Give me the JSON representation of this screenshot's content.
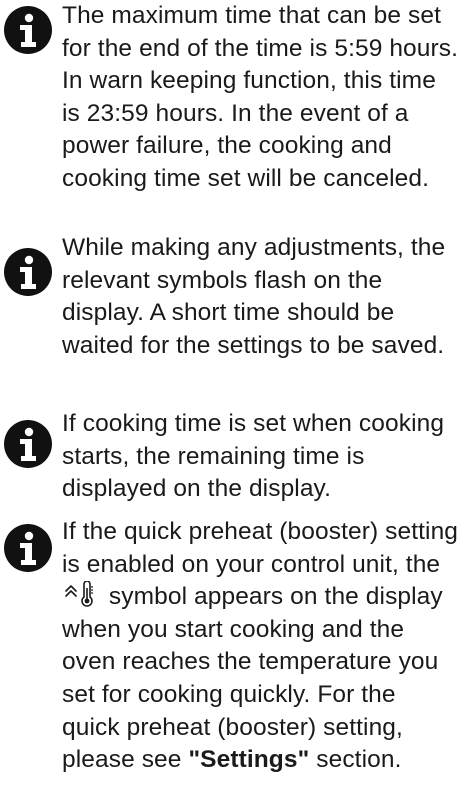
{
  "notes": [
    {
      "icon": "info-icon",
      "text": "The maximum time that can be set for the end of the time is 5:59 hours. In warn keeping function, this time is 23:59 hours. In the event of a power failure, the cooking and cooking time set will be canceled."
    },
    {
      "icon": "info-icon",
      "text": "While making any adjustments, the relevant symbols flash on the display. A short time should be waited for the settings to be saved."
    },
    {
      "icon": "info-icon",
      "text": "If cooking time is set when cooking starts, the remaining time is displayed on the display."
    },
    {
      "icon": "info-icon",
      "text_before_symbol": "If the quick preheat (booster) setting is enabled on your control unit, the",
      "symbol": "booster-preheat-icon",
      "text_after_symbol": "symbol appears on the display when you start cooking and the oven reaches the temperature you set for cooking quickly. For the quick preheat (booster) setting, please see",
      "link_text": "\"Settings\"",
      "text_end": "section."
    }
  ]
}
